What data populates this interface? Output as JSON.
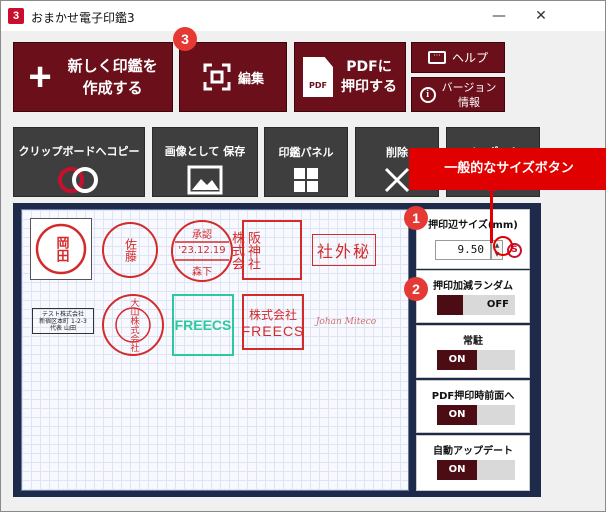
{
  "window": {
    "title": "おまかせ電子印鑑3",
    "app_icon": "3",
    "minimize": "—",
    "close": "✕"
  },
  "toolbar": {
    "new_line1": "新しく印鑑を",
    "new_line2": "作成する",
    "plus": "+",
    "edit": "編集",
    "pdf_line1": "PDFに",
    "pdf_line2": "押印する",
    "pdf_icon": "PDF",
    "help": "ヘルプ",
    "version_line1": "バージョン",
    "version_line2": "情報"
  },
  "row2": {
    "clipboard": "クリップボードへコピー",
    "save_image": "画像として 保存",
    "stamp_panel": "印鑑パネル",
    "delete": "削除",
    "import": "インポート"
  },
  "stamps": {
    "s1": "岡田",
    "s2": "佐藤",
    "s3_top": "承認",
    "s3_date": "'23.12.19",
    "s3_name": "森下",
    "s4_c1": "株式会",
    "s4_c2": "阪神社",
    "s5": "社外秘",
    "s6_line1": "テスト株式会社",
    "s6_line2": "新宿区本町 1-2-3",
    "s6_line3": "代表 山田",
    "s7": "大山株式会社",
    "s8": "FREECS",
    "s9_line1": "株式会社",
    "s9_line2": "FREECS",
    "s10": "Johan Miteco"
  },
  "side": {
    "size_label": "押印辺サイズ(mm)",
    "size_value": "9.50",
    "std_button": "S",
    "random_label": "押印加減ランダム",
    "random_state": "OFF",
    "resident_label": "常駐",
    "resident_state": "ON",
    "pdf_front_label": "PDF押印時前面へ",
    "pdf_front_state": "ON",
    "auto_update_label": "自動アップデート",
    "auto_update_state": "ON"
  },
  "callouts": {
    "tip": "一般的なサイズボタン",
    "n1": "1",
    "n2": "2",
    "n3": "3"
  },
  "colors": {
    "maroon": "#6b0f1a",
    "dark_gray": "#3e3e3e",
    "accent_red": "#e00000",
    "stamp_red": "#d42a2a",
    "stamp_green": "#2cc9a0",
    "navy": "#1e2a4a"
  },
  "icons": {
    "edit": "focus-frame-icon",
    "clipboard": "two-circles-icon",
    "save_image": "image-icon",
    "stamp_panel": "grid-icon",
    "delete": "x-icon",
    "import": "arrow-up-icon",
    "help": "chat-icon",
    "version": "info-icon"
  }
}
